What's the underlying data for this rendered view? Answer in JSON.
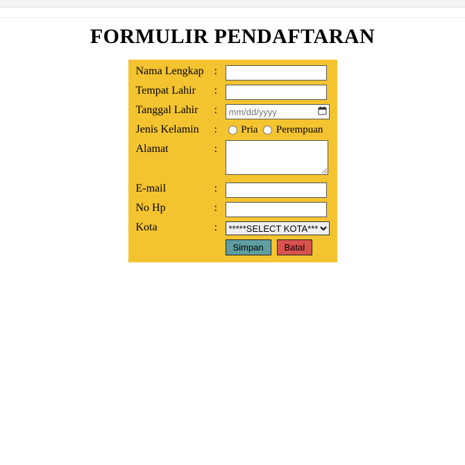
{
  "header": {
    "title": "FORMULIR PENDAFTARAN"
  },
  "form": {
    "rows": {
      "nama": {
        "label": "Nama Lengkap",
        "value": ""
      },
      "tempat": {
        "label": "Tempat Lahir",
        "value": ""
      },
      "tanggal": {
        "label": "Tanggal Lahir",
        "placeholder": "mm/dd/yyyy",
        "value": ""
      },
      "gender": {
        "label": "Jenis Kelamin",
        "options": {
          "pria": "Pria",
          "perempuan": "Perempuan"
        },
        "selected": ""
      },
      "alamat": {
        "label": "Alamat",
        "value": ""
      },
      "email": {
        "label": "E-mail",
        "value": ""
      },
      "nohp": {
        "label": "No Hp",
        "value": ""
      },
      "kota": {
        "label": "Kota",
        "selected": "*****SELECT KOTA*****",
        "options": [
          "*****SELECT KOTA*****"
        ]
      }
    },
    "buttons": {
      "save": "Simpan",
      "cancel": "Batal"
    },
    "colon": ":"
  }
}
